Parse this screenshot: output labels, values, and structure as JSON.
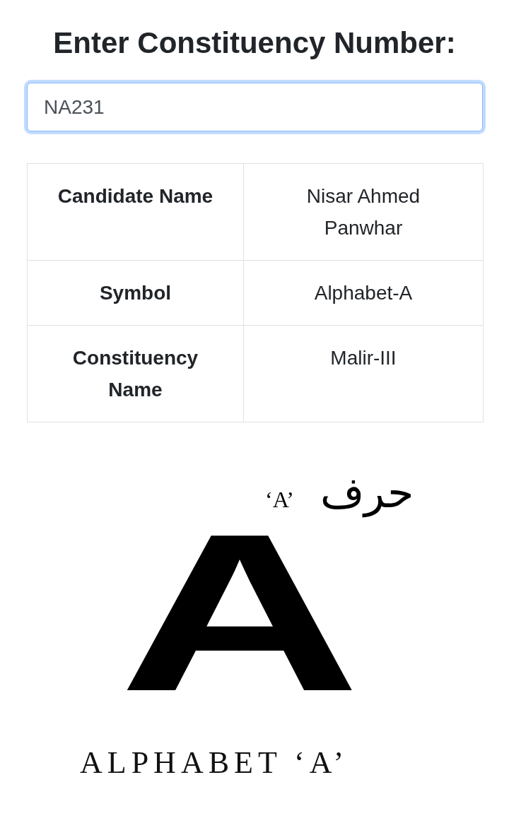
{
  "heading": "Enter Constituency Number:",
  "search": {
    "value": "NA231",
    "focused": true
  },
  "table": {
    "rows": [
      {
        "label": "Candidate Name",
        "value": "Nisar Ahmed Panwhar"
      },
      {
        "label": "Symbol",
        "value": "Alphabet-A"
      },
      {
        "label": "Constituency Name",
        "value": "Malir-III"
      }
    ]
  },
  "symbol_image": {
    "caption_top_latin": "‘A’",
    "caption_top_urdu": "حرف",
    "letter": "A",
    "caption_bottom": "ALPHABET ‘A’"
  }
}
